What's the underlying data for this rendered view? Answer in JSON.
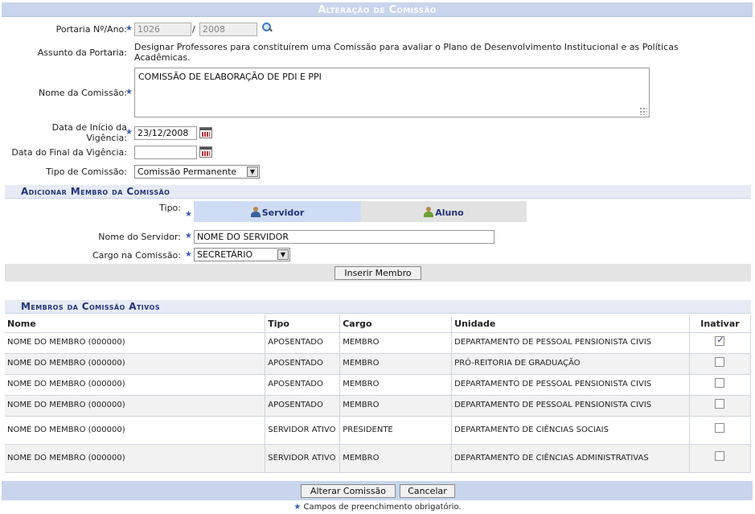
{
  "header": {
    "title": "Alteração de Comissão"
  },
  "form": {
    "portaria_label": "Portaria Nº/Ano:",
    "portaria_numero": "1026",
    "portaria_sep": "/",
    "portaria_ano": "2008",
    "assunto_label": "Assunto da Portaria:",
    "assunto_value": "Designar Professores para constituírem uma Comissão para avaliar o Plano de Desenvolvimento Institucional e as Políticas Acadêmicas.",
    "nome_label": "Nome da Comissão:",
    "nome_value": "COMISSÃO DE ELABORAÇÃO DE PDI E PPI",
    "inicio_label": "Data de Início da Vigência:",
    "inicio_value": "23/12/2008",
    "final_label": "Data do Final da Vigência:",
    "final_value": "",
    "tipo_label": "Tipo de Comissão:",
    "tipo_value": "Comissão Permanente",
    "required_star": "★"
  },
  "add_member": {
    "title": "Adicionar Membro da Comissão",
    "tipo_label": "Tipo:",
    "tab_servidor": "Servidor",
    "tab_aluno": "Aluno",
    "servidor_label": "Nome do Servidor:",
    "servidor_value": "NOME DO SERVIDOR",
    "cargo_label": "Cargo na Comissão:",
    "cargo_value": "SECRETÁRIO",
    "insert_button": "Inserir Membro"
  },
  "members": {
    "title": "Membros da Comissão Ativos",
    "columns": [
      "Nome",
      "Tipo",
      "Cargo",
      "Unidade",
      "Inativar"
    ],
    "rows": [
      {
        "nome": "NOME DO MEMBRO (000000)",
        "tipo": "APOSENTADO",
        "cargo": "MEMBRO",
        "unidade": "DEPARTAMENTO DE PESSOAL PENSIONISTA CIVIS",
        "inativar": true
      },
      {
        "nome": "NOME DO MEMBRO (000000)",
        "tipo": "APOSENTADO",
        "cargo": "MEMBRO",
        "unidade": "PRÓ-REITORIA DE GRADUAÇÃO",
        "inativar": false
      },
      {
        "nome": "NOME DO MEMBRO (000000)",
        "tipo": "APOSENTADO",
        "cargo": "MEMBRO",
        "unidade": "DEPARTAMENTO DE PESSOAL PENSIONISTA CIVIS",
        "inativar": false
      },
      {
        "nome": "NOME DO MEMBRO (000000)",
        "tipo": "APOSENTADO",
        "cargo": "MEMBRO",
        "unidade": "DEPARTAMENTO DE PESSOAL PENSIONISTA CIVIS",
        "inativar": false
      },
      {
        "nome": "NOME DO MEMBRO (000000)",
        "tipo": "SERVIDOR ATIVO",
        "cargo": "PRESIDENTE",
        "unidade": "DEPARTAMENTO DE CIÊNCIAS SOCIAIS",
        "inativar": false
      },
      {
        "nome": "NOME DO MEMBRO (000000)",
        "tipo": "SERVIDOR ATIVO",
        "cargo": "MEMBRO",
        "unidade": "DEPARTAMENTO DE CIÊNCIAS ADMINISTRATIVAS",
        "inativar": false
      }
    ]
  },
  "footer": {
    "alterar_button": "Alterar Comissão",
    "cancelar_button": "Cancelar",
    "required_note": "Campos de preenchimento obrigatório."
  }
}
